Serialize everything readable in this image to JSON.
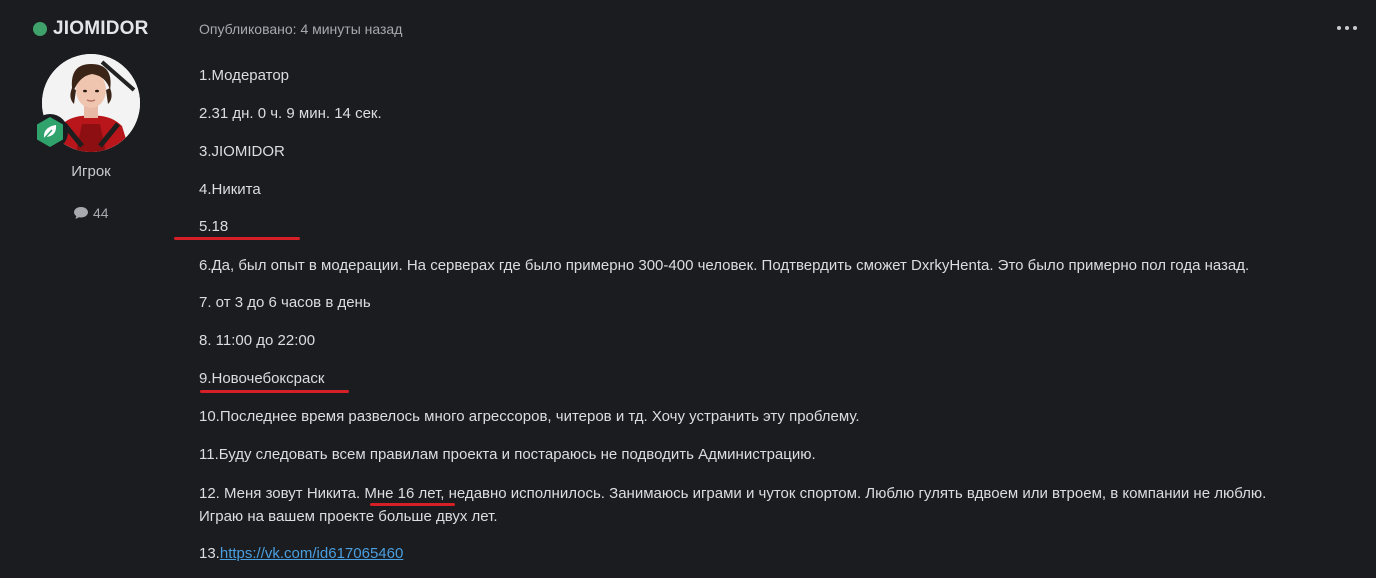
{
  "author": {
    "name": "JIOMIDOR",
    "role": "Игрок",
    "post_count": "44",
    "online_color": "#3fa26a",
    "badge_color": "#2fa36b",
    "badge_icon": "leaf-icon"
  },
  "post": {
    "meta": "Опубликовано: 4 минуты назад",
    "menu_icon": "more-horizontal-icon",
    "lines": [
      "1.Модератор",
      "2.31 дн. 0 ч. 9 мин. 14 сек.",
      "3.JIOMIDOR",
      "4.Никита",
      "5.18",
      "6.Да, был опыт в модерации. На серверах где было примерно 300-400 человек. Подтвердить сможет DxrkyHenta. Это было примерно пол года назад.",
      "7. от 3 до 6 часов в день",
      "8. 11:00 до 22:00",
      "9.Новочебоксраск",
      "10.Последнее время развелось много агрессоров, читеров и тд. Хочу устранить эту проблему.",
      "11.Буду следовать всем правилам проекта и постараюсь не подводить Администрацию.",
      "12. Меня зовут Никита. Мне 16 лет, недавно исполнилось. Занимаюсь играми и чуток спортом. Люблю гулять вдвоем или втроем, в компании не люблю.",
      "Играю на вашем проекте больше двух лет."
    ],
    "link_prefix": "13.",
    "link_text": "https://vk.com/id617065460",
    "annotation_color": "#d61f26"
  }
}
